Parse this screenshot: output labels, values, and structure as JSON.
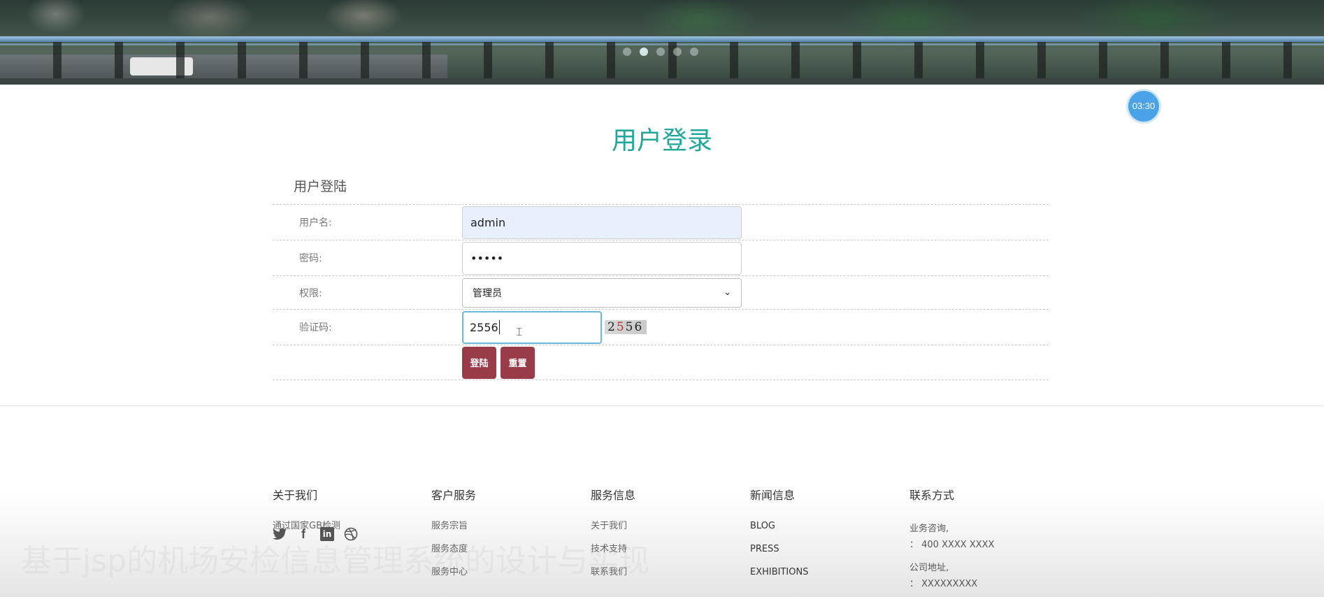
{
  "banner": {
    "slide_count": 5,
    "active_slide": 2
  },
  "timer": {
    "text": "03:30"
  },
  "page": {
    "title": "用户登录"
  },
  "form": {
    "heading": "用户登陆",
    "username_label": "用户名:",
    "username_value": "admin",
    "password_label": "密码:",
    "password_value": "•••••",
    "role_label": "权限:",
    "role_selected": "管理员",
    "captcha_label": "验证码:",
    "captcha_value": "2556",
    "captcha_image_text": [
      "2",
      "5",
      "5",
      "6"
    ],
    "login_button": "登陆",
    "reset_button": "重置"
  },
  "footer": {
    "watermark": "基于jsp的机场安检信息管理系统的设计与实现",
    "about": {
      "title": "关于我们",
      "text": "通过国家GB检测"
    },
    "service": {
      "title": "客户服务",
      "links": [
        "服务宗旨",
        "服务态度",
        "服务中心"
      ]
    },
    "info": {
      "title": "服务信息",
      "links": [
        "关于我们",
        "技术支持",
        "联系我们"
      ]
    },
    "news": {
      "title": "新闻信息",
      "links": [
        "BLOG",
        "PRESS",
        "EXHIBITIONS"
      ]
    },
    "contact": {
      "title": "联系方式",
      "consult_label": "业务咨询,",
      "consult_value": "： 400 XXXX XXXX",
      "address_label": "公司地址,",
      "address_value": "： XXXXXXXXX"
    },
    "social_icons": [
      "twitter-icon",
      "facebook-icon",
      "linkedin-icon",
      "dribbble-icon"
    ]
  }
}
